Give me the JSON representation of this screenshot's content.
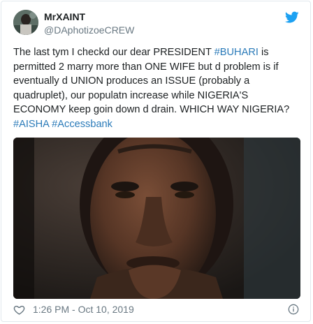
{
  "tweet": {
    "display_name": "MrXAINT",
    "handle": "@DAphotizoeCREW",
    "text_segments": [
      {
        "text": "The last tym I checkd our dear PRESIDENT ",
        "hashtag": false
      },
      {
        "text": "#BUHARI",
        "hashtag": true
      },
      {
        "text": " is permitted 2 marry more than ONE WIFE but d problem is if eventually d UNION produces an ISSUE (probably a quadruplet), our populatn increase while NIGERIA'S ECONOMY keep goin down d drain. WHICH WAY NIGERIA?",
        "hashtag": false
      },
      {
        "text": "#AISHA",
        "hashtag": true
      },
      {
        "text": " ",
        "hashtag": false
      },
      {
        "text": "#Accessbank",
        "hashtag": true
      }
    ],
    "timestamp": "1:26 PM - Oct 10, 2019"
  },
  "icons": {
    "platform": "twitter-bird-icon",
    "like": "heart-icon",
    "info": "info-icon"
  },
  "colors": {
    "link": "#2b7bb9",
    "twitter_blue": "#1da1f2",
    "muted": "#697882",
    "text": "#1c2022",
    "border": "#e1e8ed"
  }
}
